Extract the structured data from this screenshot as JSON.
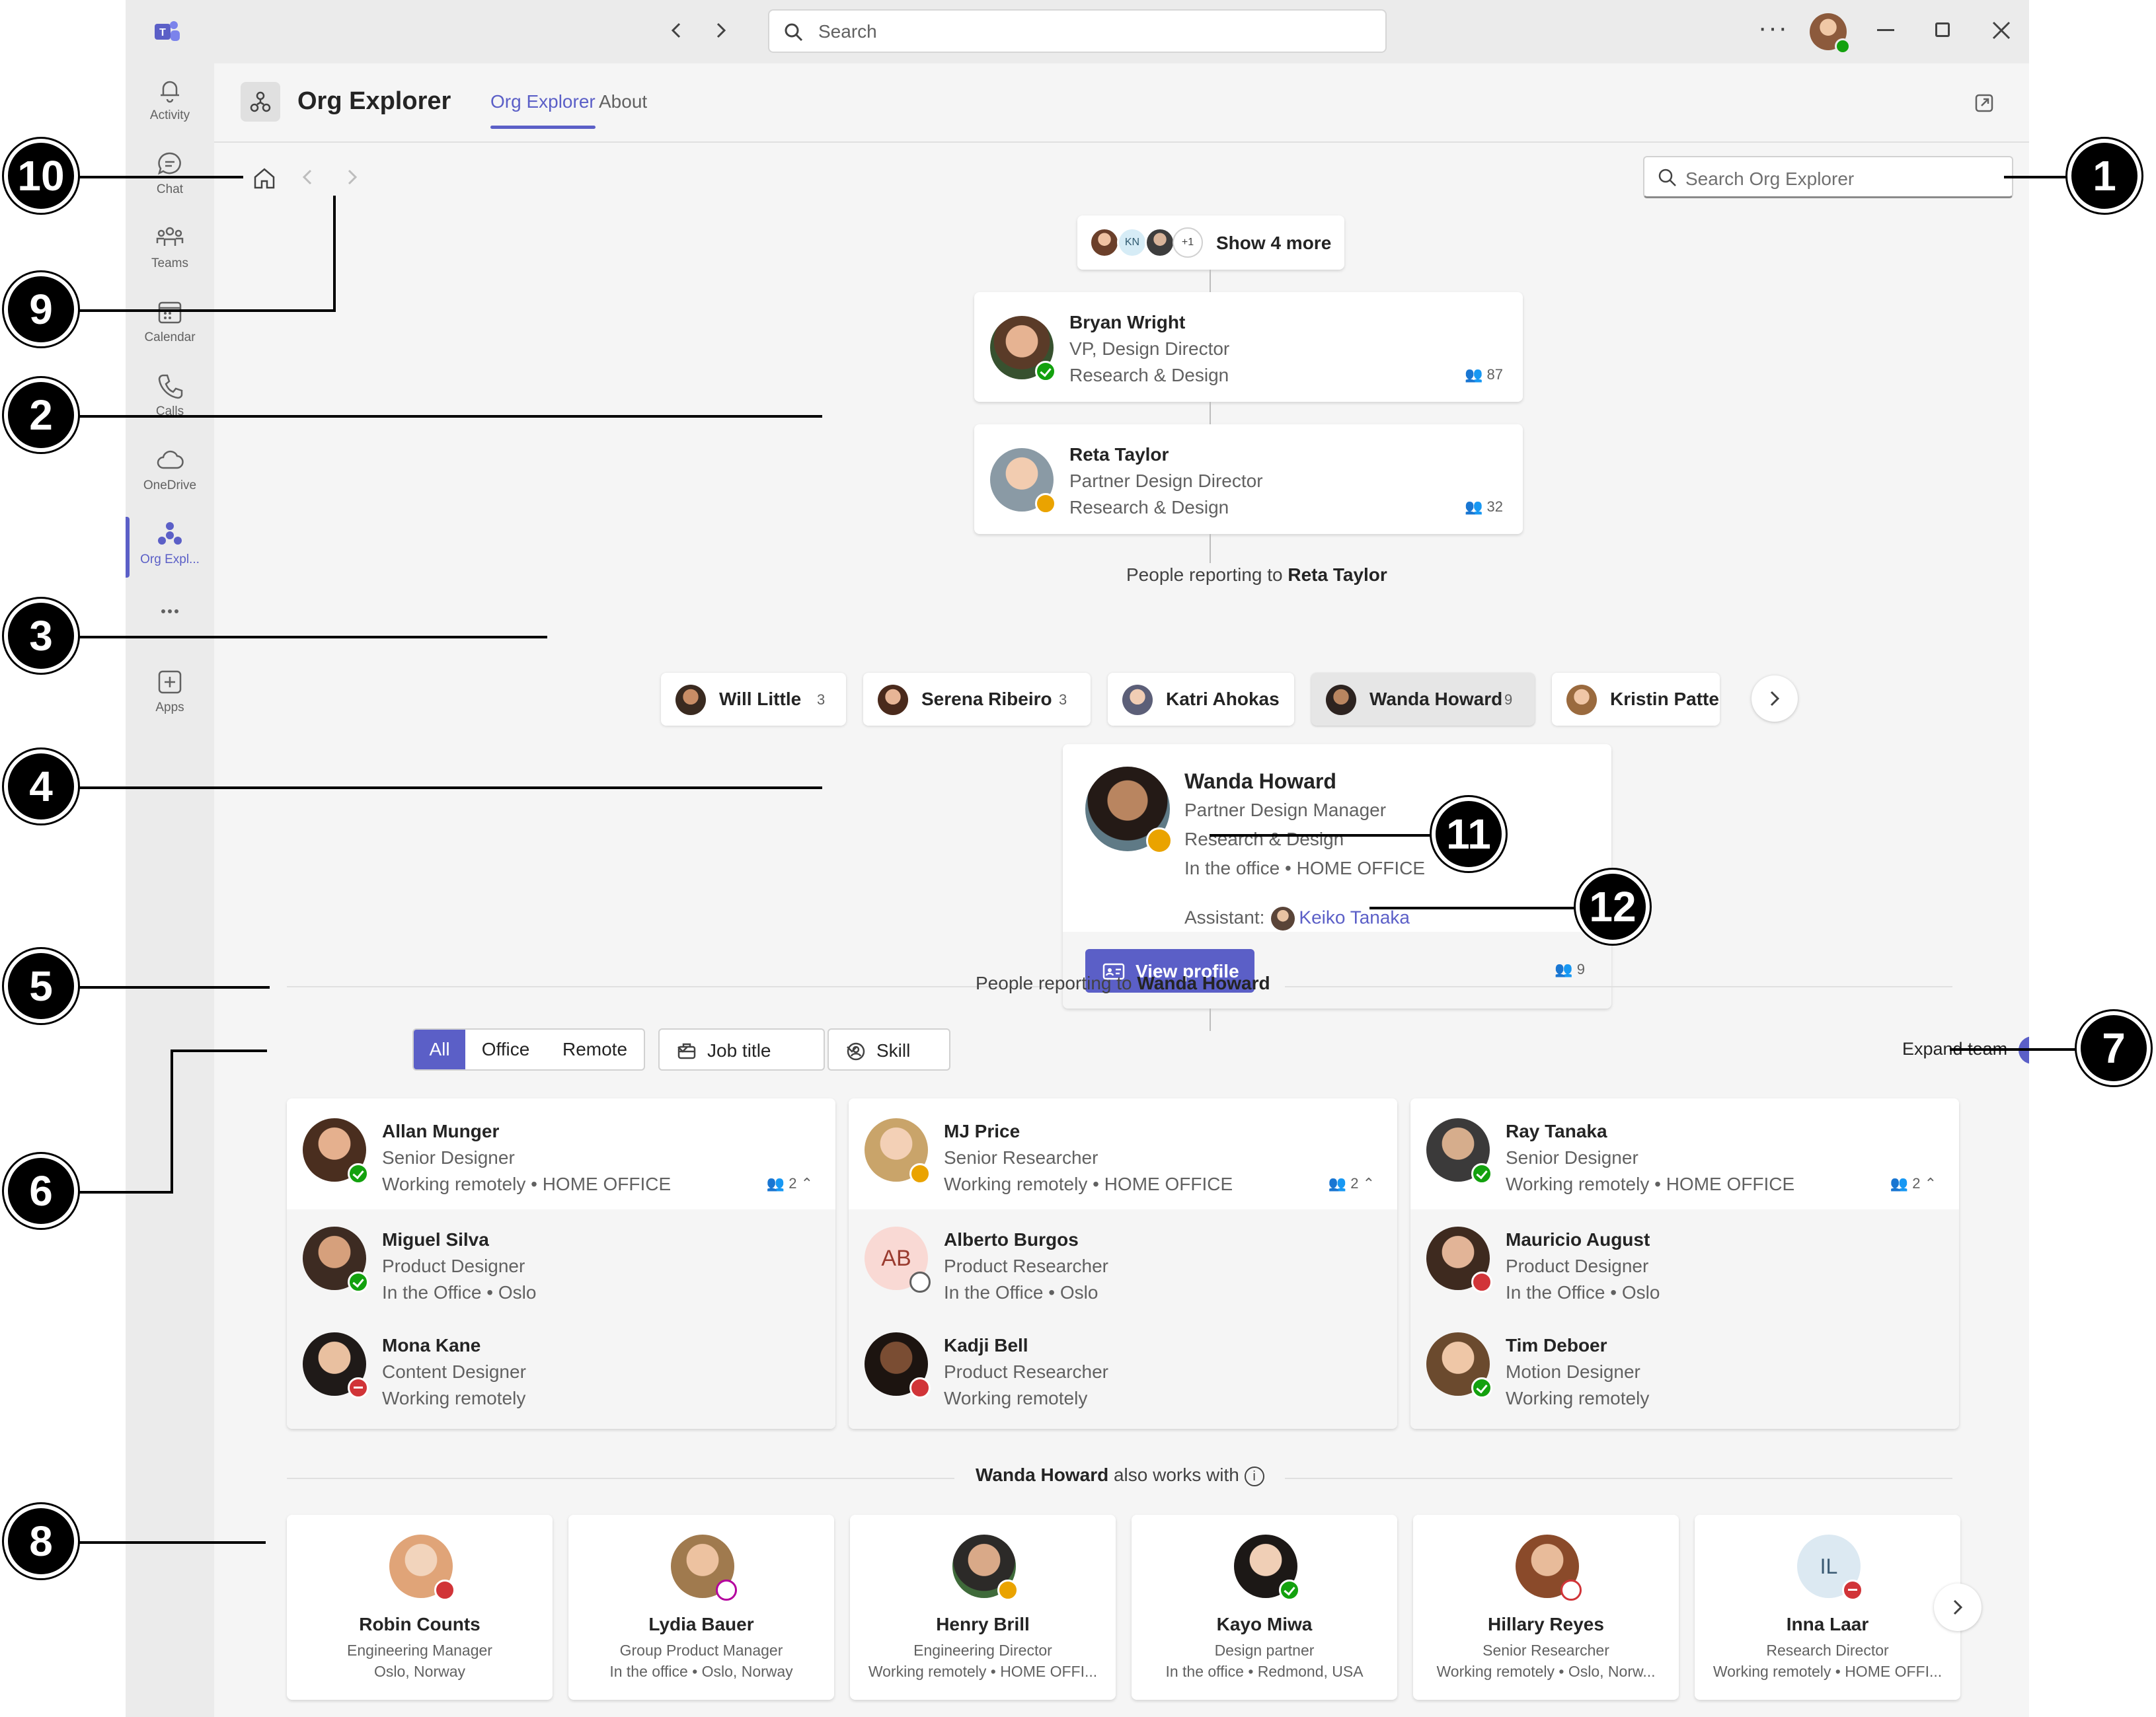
{
  "titlebar": {
    "search_placeholder": "Search",
    "more": "···"
  },
  "rail": [
    {
      "label": "Activity",
      "icon": "bell-icon"
    },
    {
      "label": "Chat",
      "icon": "chat-icon"
    },
    {
      "label": "Teams",
      "icon": "teams-icon"
    },
    {
      "label": "Calendar",
      "icon": "calendar-icon"
    },
    {
      "label": "Calls",
      "icon": "phone-icon"
    },
    {
      "label": "OneDrive",
      "icon": "cloud-icon"
    },
    {
      "label": "Org Expl...",
      "icon": "org-icon"
    },
    {
      "label": "Apps",
      "icon": "add-app-icon"
    }
  ],
  "app": {
    "title": "Org Explorer",
    "tabs": [
      "Org Explorer",
      "About"
    ],
    "search_placeholder": "Search Org Explorer"
  },
  "show_more": {
    "label": "Show 4 more",
    "initials": "KN",
    "extra": "+1"
  },
  "managers": [
    {
      "name": "Bryan Wright",
      "title": "VP, Design Director",
      "dept": "Research & Design",
      "count": "87",
      "presence": "available"
    },
    {
      "name": "Reta Taylor",
      "title": "Partner Design Director",
      "dept": "Research & Design",
      "count": "32",
      "presence": "away"
    }
  ],
  "peers_label": {
    "prefix": "People reporting to",
    "name": "Reta Taylor"
  },
  "peers": [
    {
      "name": "Will Little",
      "count": "3"
    },
    {
      "name": "Serena Ribeiro",
      "count": "3"
    },
    {
      "name": "Katri Ahokas",
      "count": ""
    },
    {
      "name": "Wanda Howard",
      "count": "9"
    },
    {
      "name": "Kristin Patte",
      "count": ""
    }
  ],
  "focus": {
    "name": "Wanda Howard",
    "title": "Partner Design Manager",
    "dept": "Research & Design",
    "location": "In the office • HOME OFFICE",
    "assistant_label": "Assistant:",
    "assistant": "Keiko Tanaka",
    "button": "View profile",
    "count": "9"
  },
  "reports_label": {
    "prefix": "People reporting to",
    "name": "Wanda Howard"
  },
  "filters": {
    "segments": [
      "All",
      "Office",
      "Remote"
    ],
    "job_title": "Job title",
    "skill": "Skill",
    "expand_team": "Expand team",
    "expand_on": true
  },
  "teams": [
    {
      "lead": {
        "name": "Allan Munger",
        "title": "Senior Designer",
        "loc": "Working remotely • HOME OFFICE",
        "count": "2",
        "presence": "available"
      },
      "members": [
        {
          "name": "Miguel Silva",
          "title": "Product Designer",
          "loc": "In the Office • Oslo",
          "presence": "available"
        },
        {
          "name": "Mona Kane",
          "title": "Content Designer",
          "loc": "Working remotely",
          "presence": "dnd"
        }
      ]
    },
    {
      "lead": {
        "name": "MJ Price",
        "title": "Senior Researcher",
        "loc": "Working remotely • HOME OFFICE",
        "count": "2",
        "presence": "away"
      },
      "members": [
        {
          "name": "Alberto Burgos",
          "title": "Product Researcher",
          "loc": "In the Office • Oslo",
          "presence": "offline",
          "initials": "AB"
        },
        {
          "name": "Kadji Bell",
          "title": "Product Researcher",
          "loc": "Working remotely",
          "presence": "busy"
        }
      ]
    },
    {
      "lead": {
        "name": "Ray Tanaka",
        "title": "Senior Designer",
        "loc": "Working remotely • HOME OFFICE",
        "count": "2",
        "presence": "available"
      },
      "members": [
        {
          "name": "Mauricio August",
          "title": "Product Designer",
          "loc": "In the Office • Oslo",
          "presence": "busy"
        },
        {
          "name": "Tim Deboer",
          "title": "Motion Designer",
          "loc": "Working remotely",
          "presence": "available"
        }
      ]
    }
  ],
  "collab_label": {
    "name": "Wanda Howard",
    "suffix": "also works with"
  },
  "collaborators": [
    {
      "name": "Robin Counts",
      "title": "Engineering Manager",
      "loc": "Oslo, Norway",
      "presence": "busy"
    },
    {
      "name": "Lydia Bauer",
      "title": "Group Product Manager",
      "loc": "In the office • Oslo, Norway",
      "presence": "oof"
    },
    {
      "name": "Henry Brill",
      "title": "Engineering Director",
      "loc": "Working remotely • HOME OFFI...",
      "presence": "away"
    },
    {
      "name": "Kayo Miwa",
      "title": "Design partner",
      "loc": "In the office • Redmond, USA",
      "presence": "available"
    },
    {
      "name": "Hillary Reyes",
      "title": "Senior Researcher",
      "loc": "Working remotely • Oslo, Norw...",
      "presence": "busyring"
    },
    {
      "name": "Inna Laar",
      "title": "Research Director",
      "loc": "Working remotely • HOME OFFI...",
      "presence": "dnd",
      "initials": "IL"
    }
  ],
  "callouts": [
    "1",
    "2",
    "3",
    "4",
    "5",
    "6",
    "7",
    "8",
    "9",
    "10",
    "11",
    "12"
  ],
  "colors": {
    "accent": "#5b5fc7",
    "available": "#13a10e",
    "away": "#eaa300",
    "busy": "#d13438"
  }
}
